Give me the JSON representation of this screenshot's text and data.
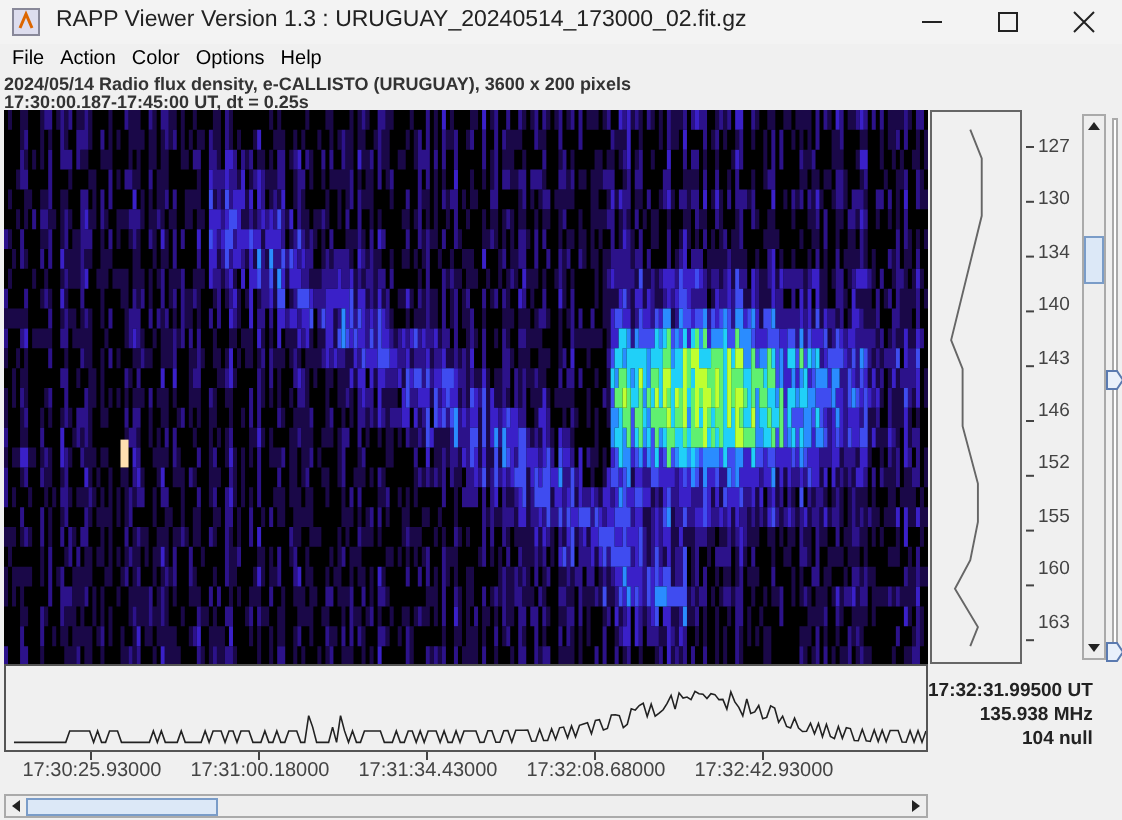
{
  "window": {
    "title": "RAPP Viewer Version 1.3 : URUGUAY_20240514_173000_02.fit.gz"
  },
  "menu": [
    "File",
    "Action",
    "Color",
    "Options",
    "Help"
  ],
  "info_lines": [
    "2024/05/14  Radio flux density, e-CALLISTO (URUGUAY),  3600 x 200 pixels",
    "17:30:00.187-17:45:00 UT,  dt = 0.25s"
  ],
  "frequency_axis": [
    "127",
    "130",
    "134",
    "140",
    "143",
    "146",
    "152",
    "155",
    "160",
    "163"
  ],
  "sliders": [
    {
      "level": 0.52
    },
    {
      "level": 0
    }
  ],
  "cursor_readout": [
    "17:32:31.99500 UT",
    "135.938 MHz",
    "104 null"
  ],
  "time_axis": [
    "17:30:25.93000",
    "17:31:00.18000",
    "17:31:34.43000",
    "17:32:08.68000",
    "17:32:42.93000"
  ]
}
